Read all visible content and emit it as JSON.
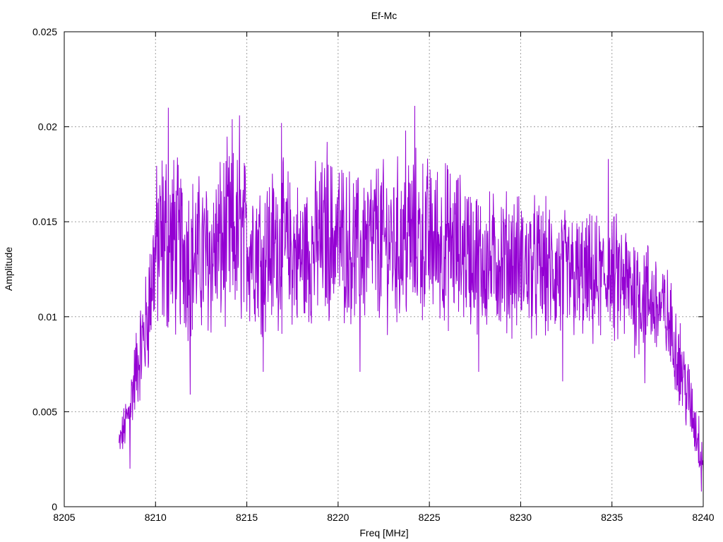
{
  "colors": {
    "series": "#9400d3",
    "grid": "#a0a0a0",
    "frame": "#000000"
  },
  "chart_data": {
    "type": "line",
    "title": "Ef-Mc",
    "xlabel": "Freq [MHz]",
    "ylabel": "Amplitude",
    "xlim": [
      8205,
      8240
    ],
    "ylim": [
      0,
      0.025
    ],
    "x_ticks": [
      8205,
      8210,
      8215,
      8220,
      8225,
      8230,
      8235,
      8240
    ],
    "x_tick_labels": [
      "8205",
      "8210",
      "8215",
      "8220",
      "8225",
      "8230",
      "8235",
      "8240"
    ],
    "y_ticks": [
      0,
      0.005,
      0.01,
      0.015,
      0.02,
      0.025
    ],
    "y_tick_labels": [
      "0",
      "0.005",
      "0.01",
      "0.015",
      "0.02",
      "0.025"
    ],
    "grid": true,
    "legend": "none",
    "series": [
      {
        "x_start": 8208.0,
        "x_step": 0.2,
        "values": [
          0.0026,
          0.005,
          0.0055,
          0.0045,
          0.0058,
          0.0062,
          0.008,
          0.0095,
          0.0102,
          0.01,
          0.0125,
          0.015,
          0.0175,
          0.016,
          0.0135,
          0.015,
          0.0125,
          0.014,
          0.0105,
          0.013,
          0.012,
          0.0145,
          0.016,
          0.012,
          0.0145,
          0.0135,
          0.0125,
          0.014,
          0.0165,
          0.012,
          0.015,
          0.0155,
          0.0135,
          0.0175,
          0.016,
          0.013,
          0.0145,
          0.014,
          0.013,
          0.017,
          0.015,
          0.014,
          0.0125,
          0.016,
          0.0145,
          0.013,
          0.014,
          0.015,
          0.012,
          0.014,
          0.0155,
          0.012,
          0.0135,
          0.015,
          0.013,
          0.0145,
          0.0125,
          0.014,
          0.016,
          0.011,
          0.0135,
          0.015,
          0.0125,
          0.0145,
          0.016,
          0.015,
          0.012,
          0.014,
          0.0155,
          0.0135,
          0.017,
          0.016,
          0.013,
          0.015,
          0.0165,
          0.0145,
          0.0125,
          0.016,
          0.0135,
          0.014,
          0.0155,
          0.0125,
          0.0145,
          0.0135,
          0.015,
          0.014,
          0.013,
          0.016,
          0.0145,
          0.0155,
          0.014,
          0.0165,
          0.013,
          0.015,
          0.0145,
          0.0135,
          0.014,
          0.0155,
          0.013,
          0.0145,
          0.015,
          0.014,
          0.013,
          0.0145,
          0.0135,
          0.014,
          0.013,
          0.0145,
          0.012,
          0.0135,
          0.014,
          0.0125,
          0.0135,
          0.013,
          0.014,
          0.0125,
          0.013,
          0.012,
          0.0135,
          0.0125,
          0.013,
          0.012,
          0.0125,
          0.013,
          0.0115,
          0.0125,
          0.012,
          0.0135,
          0.0115,
          0.012,
          0.0125,
          0.0115,
          0.012,
          0.011,
          0.013,
          0.012,
          0.0115,
          0.0125,
          0.011,
          0.012,
          0.0115,
          0.011,
          0.012,
          0.0105,
          0.0115,
          0.011,
          0.01,
          0.0115,
          0.0105,
          0.011,
          0.01,
          0.0095,
          0.0105,
          0.009,
          0.0085,
          0.0075,
          0.007,
          0.0065,
          0.006,
          0.005,
          0.0055,
          0.004,
          0.0035,
          0.0025
        ]
      }
    ],
    "envelope": {
      "x": [
        8208.0,
        8208.5,
        8209.0,
        8209.5,
        8210.0,
        8210.5,
        8211.0,
        8212.0,
        8213.0,
        8214.0,
        8215.0,
        8216.0,
        8217.0,
        8218.0,
        8219.0,
        8220.0,
        8221.0,
        8222.0,
        8223.0,
        8224.0,
        8225.0,
        8226.0,
        8227.0,
        8228.0,
        8229.0,
        8230.0,
        8231.0,
        8232.0,
        8233.0,
        8234.0,
        8235.0,
        8236.0,
        8237.0,
        8238.0,
        8238.5,
        8239.0,
        8239.5,
        8240.0
      ],
      "mean": [
        0.0032,
        0.0048,
        0.0075,
        0.0095,
        0.0135,
        0.014,
        0.0138,
        0.0132,
        0.0132,
        0.0142,
        0.014,
        0.0135,
        0.0138,
        0.013,
        0.014,
        0.0142,
        0.0135,
        0.014,
        0.0138,
        0.0142,
        0.014,
        0.0138,
        0.0135,
        0.0128,
        0.013,
        0.0128,
        0.0125,
        0.0122,
        0.012,
        0.0118,
        0.012,
        0.0115,
        0.011,
        0.01,
        0.0085,
        0.0065,
        0.0045,
        0.0025
      ],
      "amplitude": [
        0.0008,
        0.0012,
        0.002,
        0.0025,
        0.0035,
        0.0045,
        0.004,
        0.0035,
        0.0035,
        0.004,
        0.0035,
        0.0035,
        0.0035,
        0.0032,
        0.0035,
        0.0035,
        0.0032,
        0.0035,
        0.0035,
        0.0038,
        0.0035,
        0.0035,
        0.0032,
        0.003,
        0.003,
        0.003,
        0.003,
        0.003,
        0.0028,
        0.0028,
        0.0028,
        0.0028,
        0.0025,
        0.0022,
        0.002,
        0.0018,
        0.0015,
        0.0012
      ]
    },
    "peaks": [
      {
        "x": 8210.7,
        "y": 0.021
      },
      {
        "x": 8214.2,
        "y": 0.0204
      },
      {
        "x": 8214.6,
        "y": 0.0206
      },
      {
        "x": 8216.9,
        "y": 0.0202
      },
      {
        "x": 8224.2,
        "y": 0.0211
      },
      {
        "x": 8223.7,
        "y": 0.0198
      },
      {
        "x": 8219.4,
        "y": 0.0192
      },
      {
        "x": 8234.8,
        "y": 0.0183
      },
      {
        "x": 8227.7,
        "y": 0.0071
      },
      {
        "x": 8215.9,
        "y": 0.0071
      },
      {
        "x": 8221.2,
        "y": 0.0071
      },
      {
        "x": 8211.9,
        "y": 0.0059
      },
      {
        "x": 8208.6,
        "y": 0.002
      },
      {
        "x": 8239.9,
        "y": 0.0008
      },
      {
        "x": 8232.3,
        "y": 0.0066
      },
      {
        "x": 8236.8,
        "y": 0.0065
      }
    ],
    "samples": 1600
  }
}
